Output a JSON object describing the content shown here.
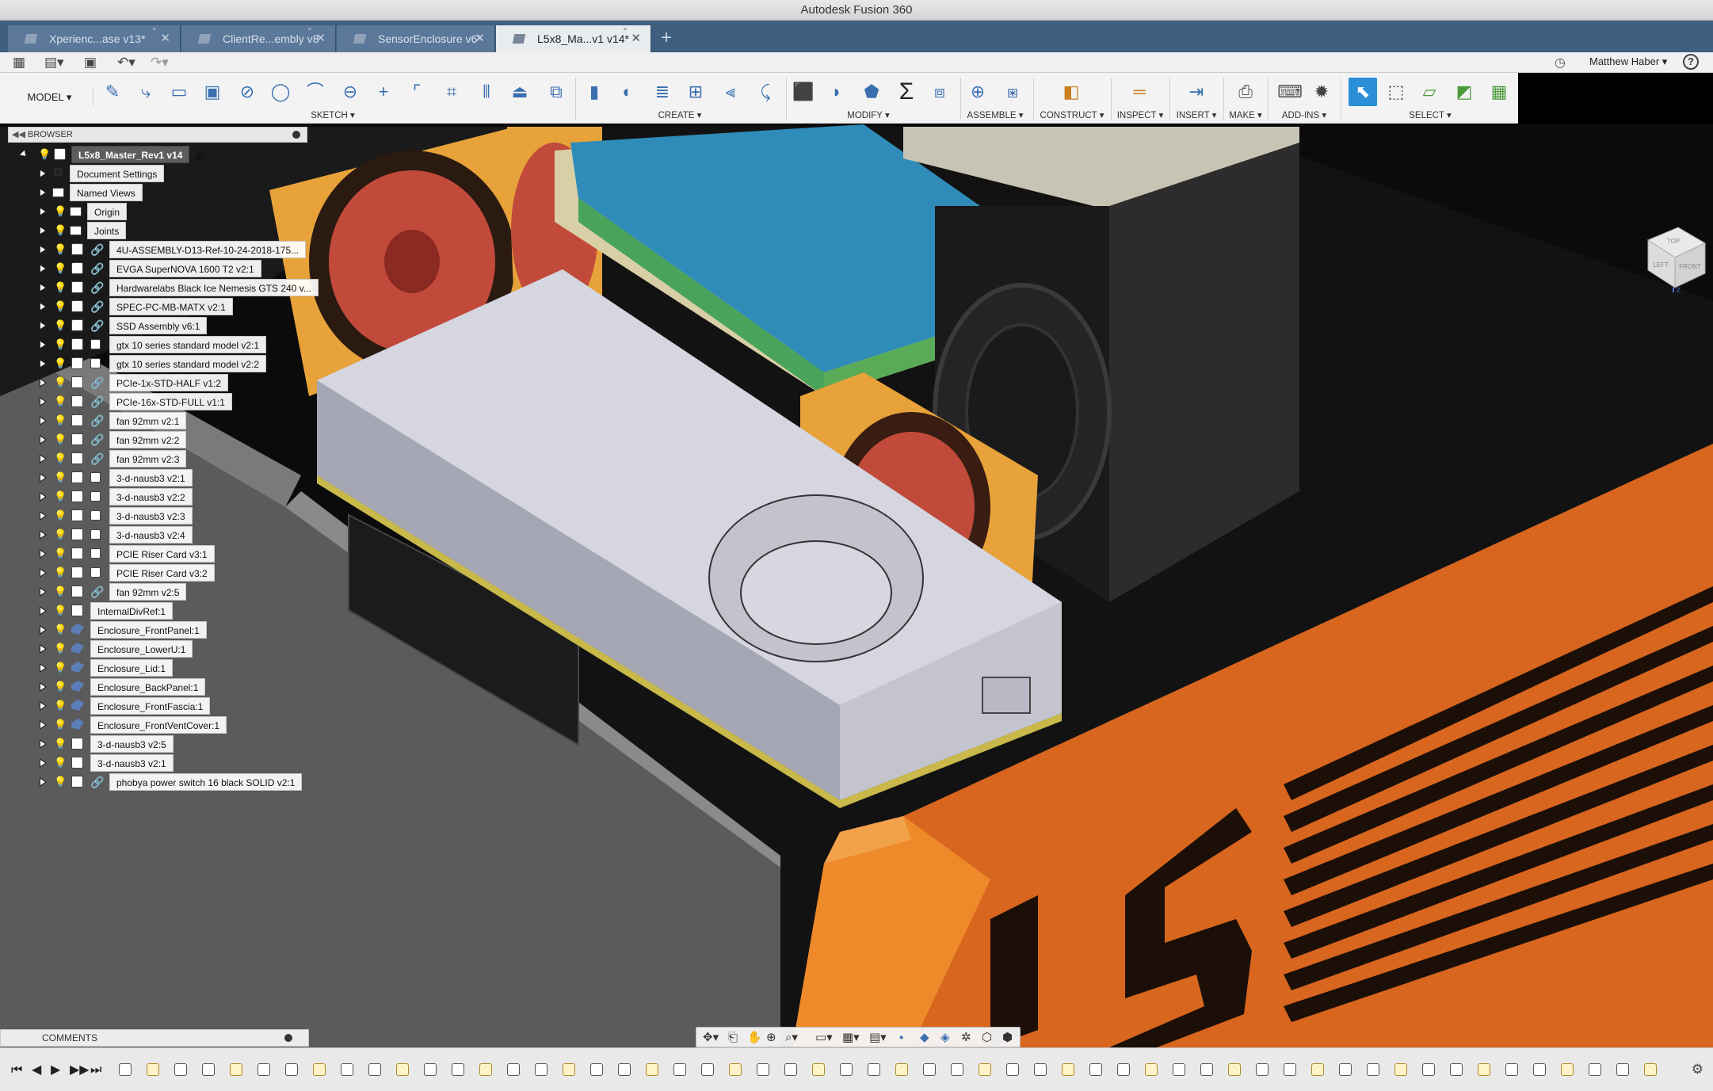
{
  "app": {
    "title": "Autodesk Fusion 360"
  },
  "tabs": [
    {
      "label": "Xperienc...ase v13*",
      "active": false
    },
    {
      "label": "ClientRe...embly v8",
      "active": false
    },
    {
      "label": "SensorEnclosure v6*",
      "active": false
    },
    {
      "label": "L5x8_Ma...v1 v14*",
      "active": true
    }
  ],
  "quick_access": {
    "user_name": "Matthew Haber ▾",
    "help_label": "?",
    "icons": [
      "apps-grid-icon",
      "file-menu-icon",
      "save-icon",
      "undo-icon",
      "redo-icon"
    ]
  },
  "toolbar": {
    "workspace": "MODEL ▾",
    "groups": [
      {
        "label": "SKETCH ▾"
      },
      {
        "label": "CREATE ▾"
      },
      {
        "label": "MODIFY ▾"
      },
      {
        "label": "ASSEMBLE ▾"
      },
      {
        "label": "CONSTRUCT ▾"
      },
      {
        "label": "INSPECT ▾"
      },
      {
        "label": "INSERT ▾"
      },
      {
        "label": "MAKE ▾"
      },
      {
        "label": "ADD-INS ▾"
      },
      {
        "label": "SELECT ▾"
      }
    ]
  },
  "browser": {
    "title": "BROWSER",
    "root": "L5x8_Master_Rev1 v14",
    "items": [
      {
        "label": "Document Settings",
        "kind": "settings"
      },
      {
        "label": "Named Views",
        "kind": "folder"
      },
      {
        "label": "Origin",
        "kind": "folder-bulb"
      },
      {
        "label": "Joints",
        "kind": "folder-bulb"
      },
      {
        "label": "4U-ASSEMBLY-D13-Ref-10-24-2018-175...",
        "kind": "linked",
        "visible": false
      },
      {
        "label": "EVGA SuperNOVA 1600 T2 v2:1",
        "kind": "linked",
        "visible": true
      },
      {
        "label": "Hardwarelabs Black Ice Nemesis GTS 240 v...",
        "kind": "linked",
        "visible": true
      },
      {
        "label": "SPEC-PC-MB-MATX v2:1",
        "kind": "linked",
        "visible": true
      },
      {
        "label": "SSD Assembly v6:1",
        "kind": "linked",
        "visible": true
      },
      {
        "label": "gtx 10 series standard model v2:1",
        "kind": "component",
        "visible": true
      },
      {
        "label": "gtx 10 series standard model v2:2",
        "kind": "component",
        "visible": true
      },
      {
        "label": "PCIe-1x-STD-HALF v1:2",
        "kind": "linked",
        "visible": true
      },
      {
        "label": "PCIe-16x-STD-FULL v1:1",
        "kind": "linked",
        "visible": true
      },
      {
        "label": "fan 92mm v2:1",
        "kind": "linked",
        "visible": true
      },
      {
        "label": "fan 92mm v2:2",
        "kind": "linked",
        "visible": true
      },
      {
        "label": "fan 92mm v2:3",
        "kind": "linked",
        "visible": true
      },
      {
        "label": "3-d-nausb3 v2:1",
        "kind": "component",
        "visible": true
      },
      {
        "label": "3-d-nausb3 v2:2",
        "kind": "component",
        "visible": true
      },
      {
        "label": "3-d-nausb3 v2:3",
        "kind": "component",
        "visible": true
      },
      {
        "label": "3-d-nausb3 v2:4",
        "kind": "component",
        "visible": true
      },
      {
        "label": "PCIE Riser Card v3:1",
        "kind": "component",
        "visible": true
      },
      {
        "label": "PCIE Riser Card v3:2",
        "kind": "component",
        "visible": true
      },
      {
        "label": "fan 92mm v2:5",
        "kind": "linked",
        "visible": true
      },
      {
        "label": "InternalDivRef:1",
        "kind": "plain",
        "visible": false
      },
      {
        "label": "Enclosure_FrontPanel:1",
        "kind": "body",
        "visible": true
      },
      {
        "label": "Enclosure_LowerU:1",
        "kind": "body",
        "visible": true
      },
      {
        "label": "Enclosure_Lid:1",
        "kind": "body",
        "visible": false
      },
      {
        "label": "Enclosure_BackPanel:1",
        "kind": "body",
        "visible": true
      },
      {
        "label": "Enclosure_FrontFascia:1",
        "kind": "body",
        "visible": true
      },
      {
        "label": "Enclosure_FrontVentCover:1",
        "kind": "body",
        "visible": true
      },
      {
        "label": "3-d-nausb3 v2:5",
        "kind": "plain",
        "visible": true
      },
      {
        "label": "3-d-nausb3 v2:1",
        "kind": "plain",
        "visible": true
      },
      {
        "label": "phobya power switch 16 black SOLID v2:1",
        "kind": "linked",
        "visible": true
      }
    ]
  },
  "comments": {
    "title": "COMMENTS"
  },
  "viewcube": {
    "faces": [
      "TOP",
      "FRONT",
      "LEFT"
    ],
    "axis": "Z"
  },
  "colors": {
    "tab_strip": "#3f5e80",
    "accent_blue": "#3a6fb0",
    "enclosure_orange": "#d8661f",
    "fan_orange": "#e8a23a",
    "motherboard_blue": "#2f8cb8",
    "gpu_body": "#c9cad4"
  }
}
